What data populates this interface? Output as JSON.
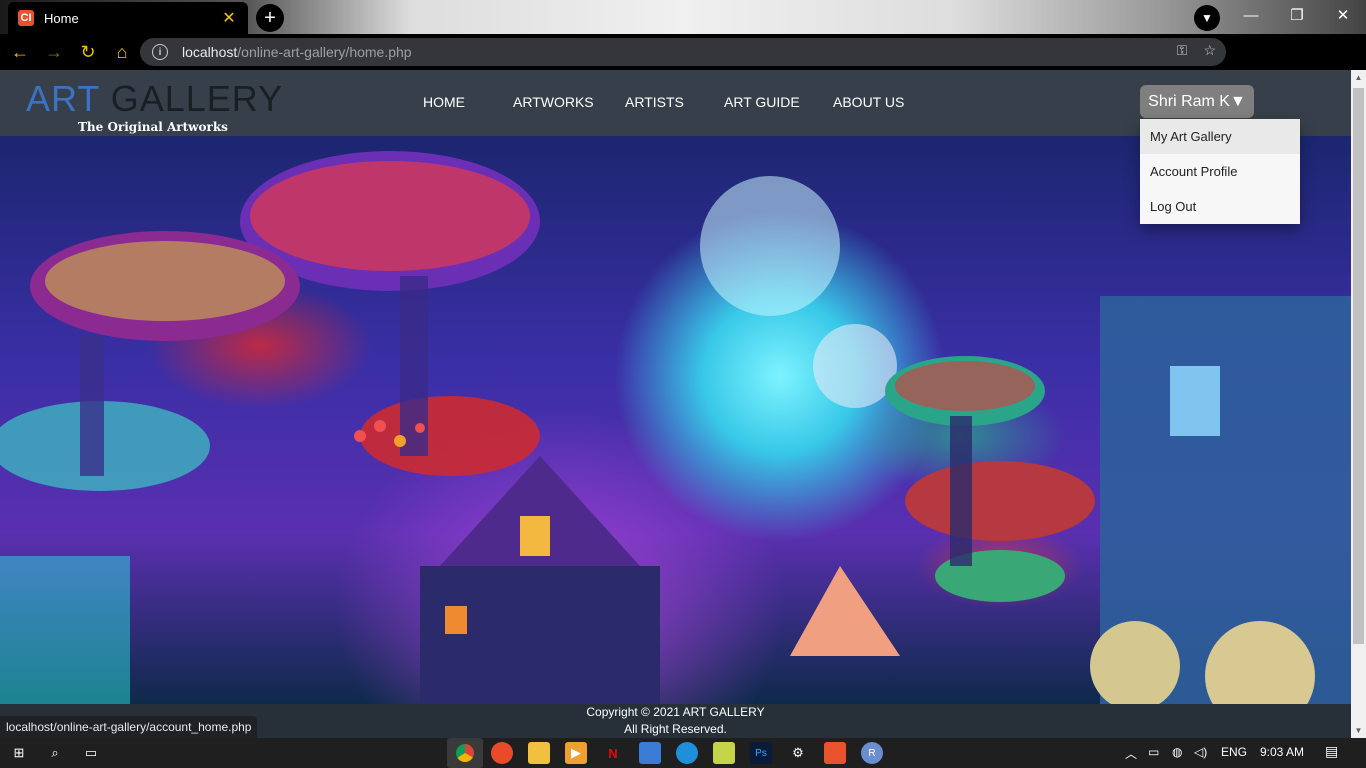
{
  "browser": {
    "tab_title": "Home",
    "tab_favicon": "CI",
    "new_tab": "+",
    "close_tab": "✕",
    "minimize": "—",
    "maximize": "❐",
    "close_window": "✕",
    "url_host": "localhost",
    "url_path": "/online-art-gallery/home.php",
    "status_url": "localhost/online-art-gallery/account_home.php"
  },
  "site": {
    "logo_art": "ART",
    "logo_gallery": " GALLERY",
    "logo_sub": "The Original Artworks",
    "nav": [
      "HOME",
      "ARTWORKS",
      "ARTISTS",
      "ART GUIDE",
      "ABOUT US"
    ],
    "user_button": "Shri Ram K▼",
    "dropdown": [
      "My Art Gallery",
      "Account Profile",
      "Log Out"
    ],
    "footer_line1": "Copyright © 2021 ART GALLERY",
    "footer_line2": "All Right Reserved."
  },
  "taskbar": {
    "lang": "ENG",
    "time": "9:03 AM"
  },
  "colors": {
    "header_bg": "#37404a",
    "logo_accent": "#3a72c4",
    "user_button_bg": "#7f7f7f",
    "footer_bg": "#273038"
  }
}
